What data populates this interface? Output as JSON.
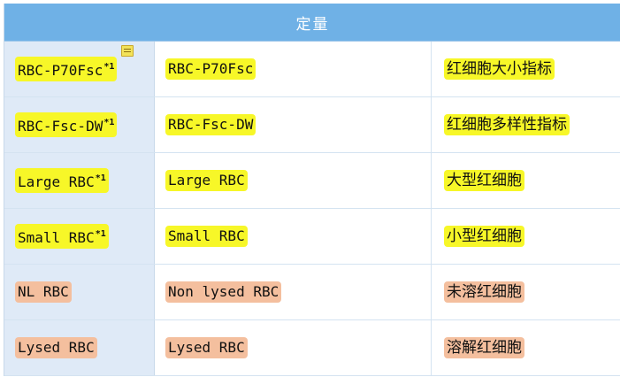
{
  "header": {
    "title": "定量"
  },
  "rows": [
    {
      "param": "RBC-P70Fsc",
      "sup": "*1",
      "name": "RBC-P70Fsc",
      "desc": "红细胞大小指标",
      "highlight": "#f7f728",
      "note_icon": "note-icon"
    },
    {
      "param": "RBC-Fsc-DW",
      "sup": "*1",
      "name": "RBC-Fsc-DW",
      "desc": "红细胞多样性指标",
      "highlight": "#f7f728"
    },
    {
      "param": "Large RBC",
      "sup": "*1",
      "name": "Large RBC",
      "desc": "大型红细胞",
      "highlight": "#f7f728"
    },
    {
      "param": "Small RBC",
      "sup": "*1",
      "name": "Small RBC",
      "desc": "小型红细胞",
      "highlight": "#f7f728"
    },
    {
      "param": "NL RBC",
      "sup": "",
      "name": "Non lysed RBC",
      "desc": "未溶红细胞",
      "highlight": "#f4bf9e"
    },
    {
      "param": "Lysed RBC",
      "sup": "",
      "name": "Lysed RBC",
      "desc": "溶解红细胞",
      "highlight": "#f4bf9e"
    }
  ],
  "colors": {
    "header_bg": "#6fb1e6",
    "first_col_bg": "#dfeaf7",
    "yellow_highlight": "#f7f728",
    "orange_highlight": "#f4bf9e"
  }
}
